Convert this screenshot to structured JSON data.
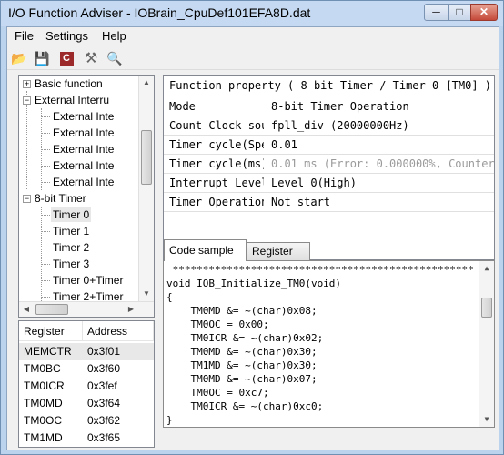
{
  "window": {
    "title": "I/O Function Adviser - IOBrain_CpuDef101EFA8D.dat",
    "minimize_glyph": "─",
    "maximize_glyph": "□",
    "close_glyph": "✕"
  },
  "menu": [
    "File",
    "Settings",
    "Help"
  ],
  "toolbar": [
    {
      "icon": "open-folder-icon",
      "glyph": "📂"
    },
    {
      "icon": "save-disk-icon",
      "glyph": "💾"
    },
    {
      "icon": "c-source-icon",
      "glyph": "C"
    },
    {
      "icon": "tools-icon",
      "glyph": "⚒"
    },
    {
      "icon": "search-icon",
      "glyph": "🔍"
    }
  ],
  "tree": {
    "items": [
      {
        "label": "Basic function",
        "level": 0,
        "expander": "+"
      },
      {
        "label": "External Interru",
        "level": 0,
        "expander": "−"
      },
      {
        "label": "External Inte",
        "level": 1
      },
      {
        "label": "External Inte",
        "level": 1
      },
      {
        "label": "External Inte",
        "level": 1
      },
      {
        "label": "External Inte",
        "level": 1
      },
      {
        "label": "External Inte",
        "level": 1
      },
      {
        "label": "8-bit Timer",
        "level": 0,
        "expander": "−"
      },
      {
        "label": "Timer 0",
        "level": 1,
        "selected": true
      },
      {
        "label": "Timer 1",
        "level": 1
      },
      {
        "label": "Timer 2",
        "level": 1
      },
      {
        "label": "Timer 3",
        "level": 1
      },
      {
        "label": "Timer 0+Timer",
        "level": 1
      },
      {
        "label": "Timer 2+Timer",
        "level": 1
      }
    ]
  },
  "registers": {
    "columns": [
      "Register",
      "Address"
    ],
    "rows": [
      {
        "register": "MEMCTR",
        "address": "0x3f01",
        "selected": true
      },
      {
        "register": "TM0BC",
        "address": "0x3f60"
      },
      {
        "register": "TM0ICR",
        "address": "0x3fef"
      },
      {
        "register": "TM0MD",
        "address": "0x3f64"
      },
      {
        "register": "TM0OC",
        "address": "0x3f62"
      },
      {
        "register": "TM1MD",
        "address": "0x3f65"
      }
    ]
  },
  "properties": {
    "title": "Function property ( 8-bit Timer / Timer 0 [TM0] )",
    "rows": [
      {
        "name": "Mode",
        "value": "8-bit Timer Operation"
      },
      {
        "name": "Count Clock sou",
        "value": "fpll_div (20000000Hz)"
      },
      {
        "name": "Timer cycle(Spe",
        "value": "0.01"
      },
      {
        "name": "Timer cycle(ms)",
        "value": "0.01 ms (Error: 0.000000%, Counter",
        "muted": true
      },
      {
        "name": "Interrupt Level",
        "value": "Level 0(High)"
      },
      {
        "name": "Timer Operation",
        "value": "Not start"
      }
    ]
  },
  "tabs": [
    {
      "label": "Code sample",
      "active": true
    },
    {
      "label": "Register",
      "active": false
    }
  ],
  "code": {
    "lines": [
      " **************************************************",
      "void IOB_Initialize_TM0(void)",
      "{",
      "    TM0MD &= ~(char)0x08;",
      "    TM0OC = 0x00;",
      "    TM0ICR &= ~(char)0x02;",
      "    TM0MD &= ~(char)0x30;",
      "    TM1MD &= ~(char)0x30;",
      "    TM0MD &= ~(char)0x07;",
      "    TM0OC = 0xc7;",
      "    TM0ICR &= ~(char)0xc0;",
      "}"
    ]
  },
  "colors": {
    "window_frame": "#bcd3ee",
    "client_bg": "#f0f0f0",
    "muted_text": "#9a9a9a",
    "close_button": "#c4493a"
  }
}
